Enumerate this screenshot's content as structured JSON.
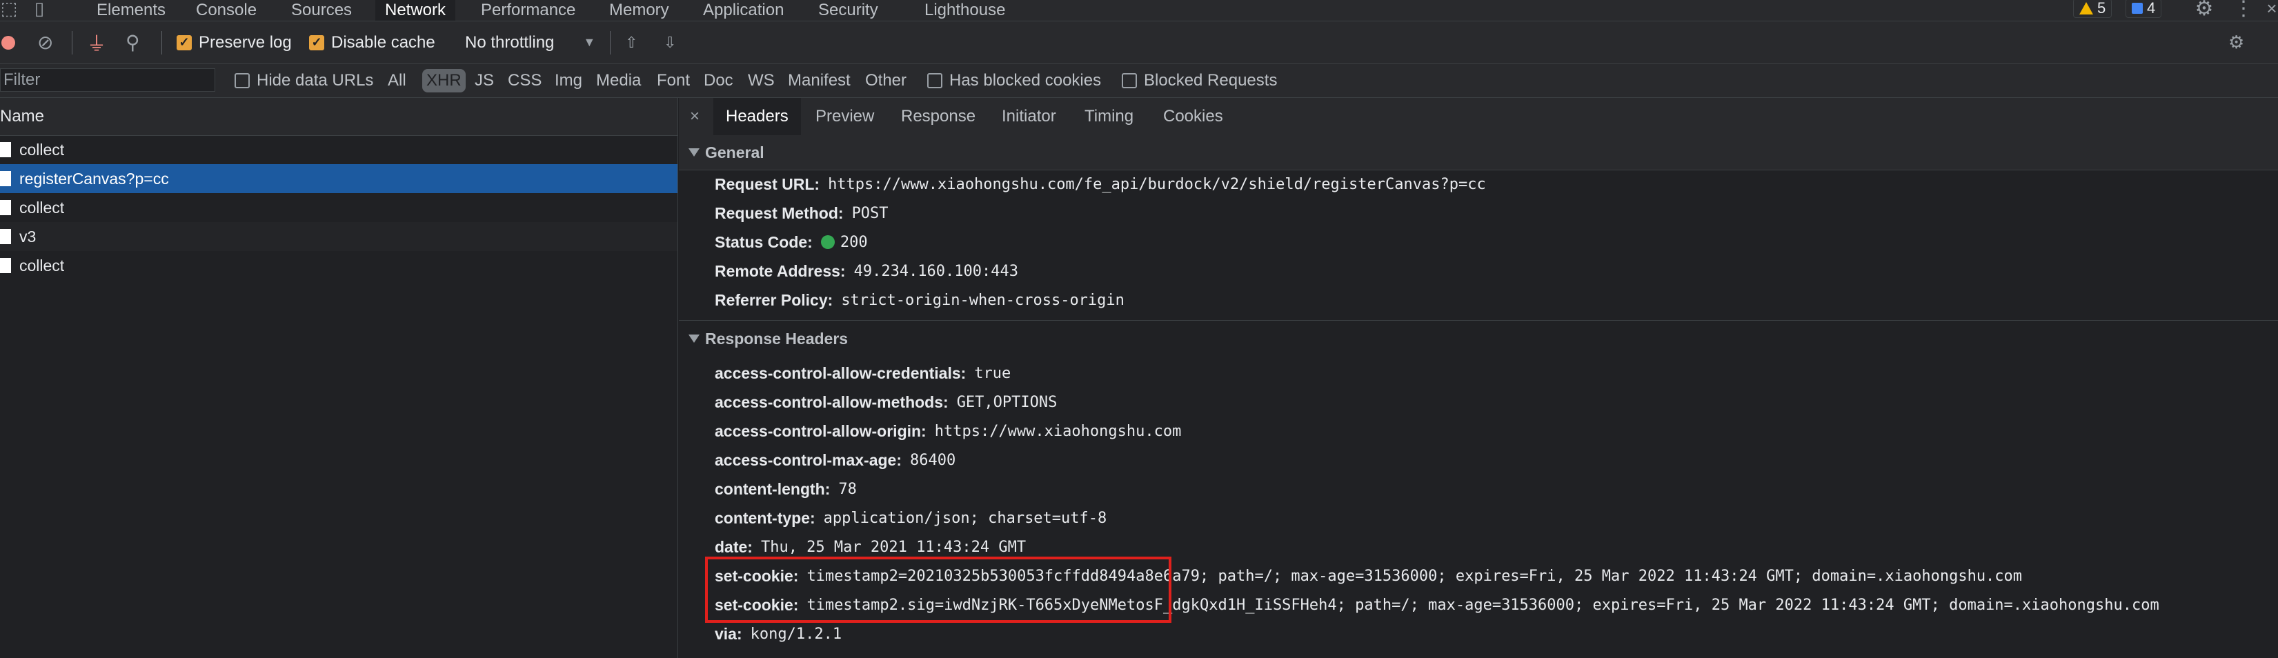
{
  "top_tabs": [
    "Elements",
    "Console",
    "Sources",
    "Network",
    "Performance",
    "Memory",
    "Application",
    "Security",
    "Lighthouse"
  ],
  "active_tab": "Network",
  "badges": {
    "warnings": "5",
    "messages": "4"
  },
  "toolbar": {
    "preserve_log": "Preserve log",
    "disable_cache": "Disable cache",
    "throttling": "No throttling"
  },
  "filter": {
    "placeholder": "Filter",
    "hide_data_urls": "Hide data URLs",
    "types": [
      "All",
      "XHR",
      "JS",
      "CSS",
      "Img",
      "Media",
      "Font",
      "Doc",
      "WS",
      "Manifest",
      "Other"
    ],
    "selected_type": "XHR",
    "has_blocked_cookies": "Has blocked cookies",
    "blocked_requests": "Blocked Requests"
  },
  "request_list": {
    "header": "Name",
    "rows": [
      {
        "name": "collect"
      },
      {
        "name": "registerCanvas?p=cc"
      },
      {
        "name": "collect"
      },
      {
        "name": "v3"
      },
      {
        "name": "collect"
      }
    ],
    "selected_index": 1
  },
  "detail_tabs": [
    "Headers",
    "Preview",
    "Response",
    "Initiator",
    "Timing",
    "Cookies"
  ],
  "detail_active_tab": "Headers",
  "general": {
    "title": "General",
    "rows": [
      {
        "key": "Request URL:",
        "value": "https://www.xiaohongshu.com/fe_api/burdock/v2/shield/registerCanvas?p=cc"
      },
      {
        "key": "Request Method:",
        "value": "POST"
      },
      {
        "key": "Status Code:",
        "value": "200"
      },
      {
        "key": "Remote Address:",
        "value": "49.234.160.100:443"
      },
      {
        "key": "Referrer Policy:",
        "value": "strict-origin-when-cross-origin"
      }
    ]
  },
  "response_headers": {
    "title": "Response Headers",
    "rows": [
      {
        "key": "access-control-allow-credentials:",
        "value": "true"
      },
      {
        "key": "access-control-allow-methods:",
        "value": "GET,OPTIONS"
      },
      {
        "key": "access-control-allow-origin:",
        "value": "https://www.xiaohongshu.com"
      },
      {
        "key": "access-control-max-age:",
        "value": "86400"
      },
      {
        "key": "content-length:",
        "value": "78"
      },
      {
        "key": "content-type:",
        "value": "application/json; charset=utf-8"
      },
      {
        "key": "date:",
        "value": "Thu, 25 Mar 2021 11:43:24 GMT"
      },
      {
        "key": "set-cookie:",
        "value": "timestamp2=20210325b530053fcffdd8494a8e6a79; path=/; max-age=31536000; expires=Fri, 25 Mar 2022 11:43:24 GMT; domain=.xiaohongshu.com"
      },
      {
        "key": "set-cookie:",
        "value": "timestamp2.sig=iwdNzjRK-T665xDyeNMetosF_dgkQxd1H_IiSSFHeh4; path=/; max-age=31536000; expires=Fri, 25 Mar 2022 11:43:24 GMT; domain=.xiaohongshu.com"
      },
      {
        "key": "via:",
        "value": "kong/1.2.1"
      }
    ]
  },
  "colors": {
    "highlight_box": "#e0201c",
    "selected_row": "#1c5aa0",
    "status_ok": "#34a853"
  }
}
